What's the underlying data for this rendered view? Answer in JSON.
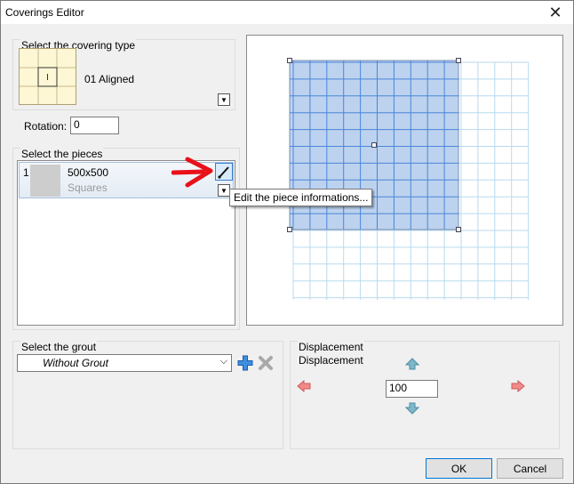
{
  "window": {
    "title": "Coverings Editor"
  },
  "covering_type": {
    "group_label": "Select the covering type",
    "selected_name": "01 Aligned"
  },
  "rotation": {
    "label": "Rotation:",
    "value": "0"
  },
  "pieces": {
    "group_label": "Select the pieces",
    "items": [
      {
        "index": "1",
        "size": "500x500",
        "shape": "Squares"
      }
    ],
    "tooltip": "Edit the piece informations..."
  },
  "grout": {
    "group_label": "Select the grout",
    "selected": "Without Grout"
  },
  "displacement": {
    "group_label": "Displacement",
    "label": "Displacement",
    "value": "100"
  },
  "buttons": {
    "ok": "OK",
    "cancel": "Cancel"
  },
  "colors": {
    "annotation_arrow": "#e8101a",
    "tile_fill": "#bcd2ee",
    "grid_line": "#4a86d9",
    "grid_faint": "#b8daf0"
  }
}
